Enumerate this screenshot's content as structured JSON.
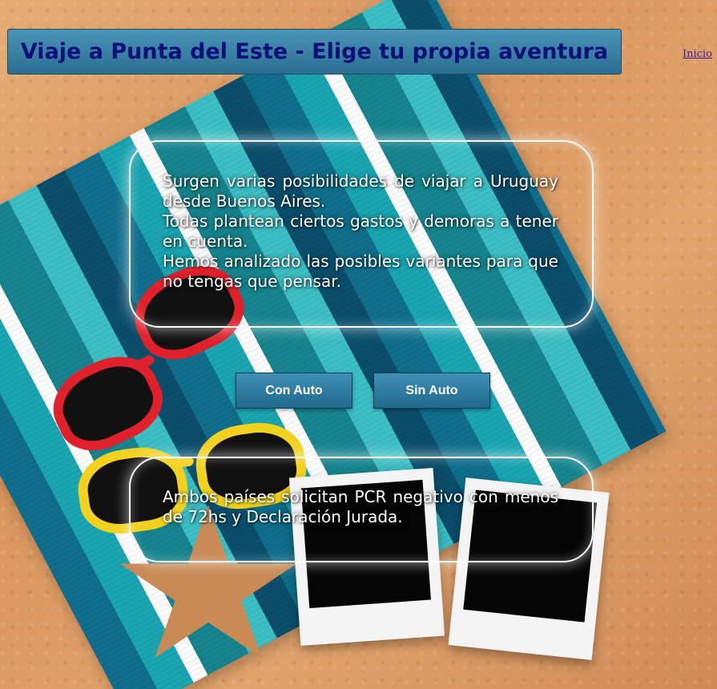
{
  "header": {
    "title": "Viaje a Punta del Este - Elige tu propia aventura"
  },
  "nav": {
    "home_link": "Inicio"
  },
  "intro": {
    "lines": [
      "Surgen varias posibilidades de viajar a Uruguay desde Buenos Aires.",
      "Todas plantean ciertos gastos y demoras a tener en cuenta.",
      "Hemos analizado las posibles variantes para que no tengas que pensar."
    ]
  },
  "buttons": {
    "with_car": "Con Auto",
    "without_car": "Sin Auto"
  },
  "notice": {
    "text": "Ambos países solicitan PCR negativo con menos de 72hs y Declaración Jurada."
  },
  "colors": {
    "title_bg": "#2f7aa0",
    "title_text": "#0b0f7a",
    "button_bg": "#2a7aa0",
    "box_border": "#ffffff"
  }
}
